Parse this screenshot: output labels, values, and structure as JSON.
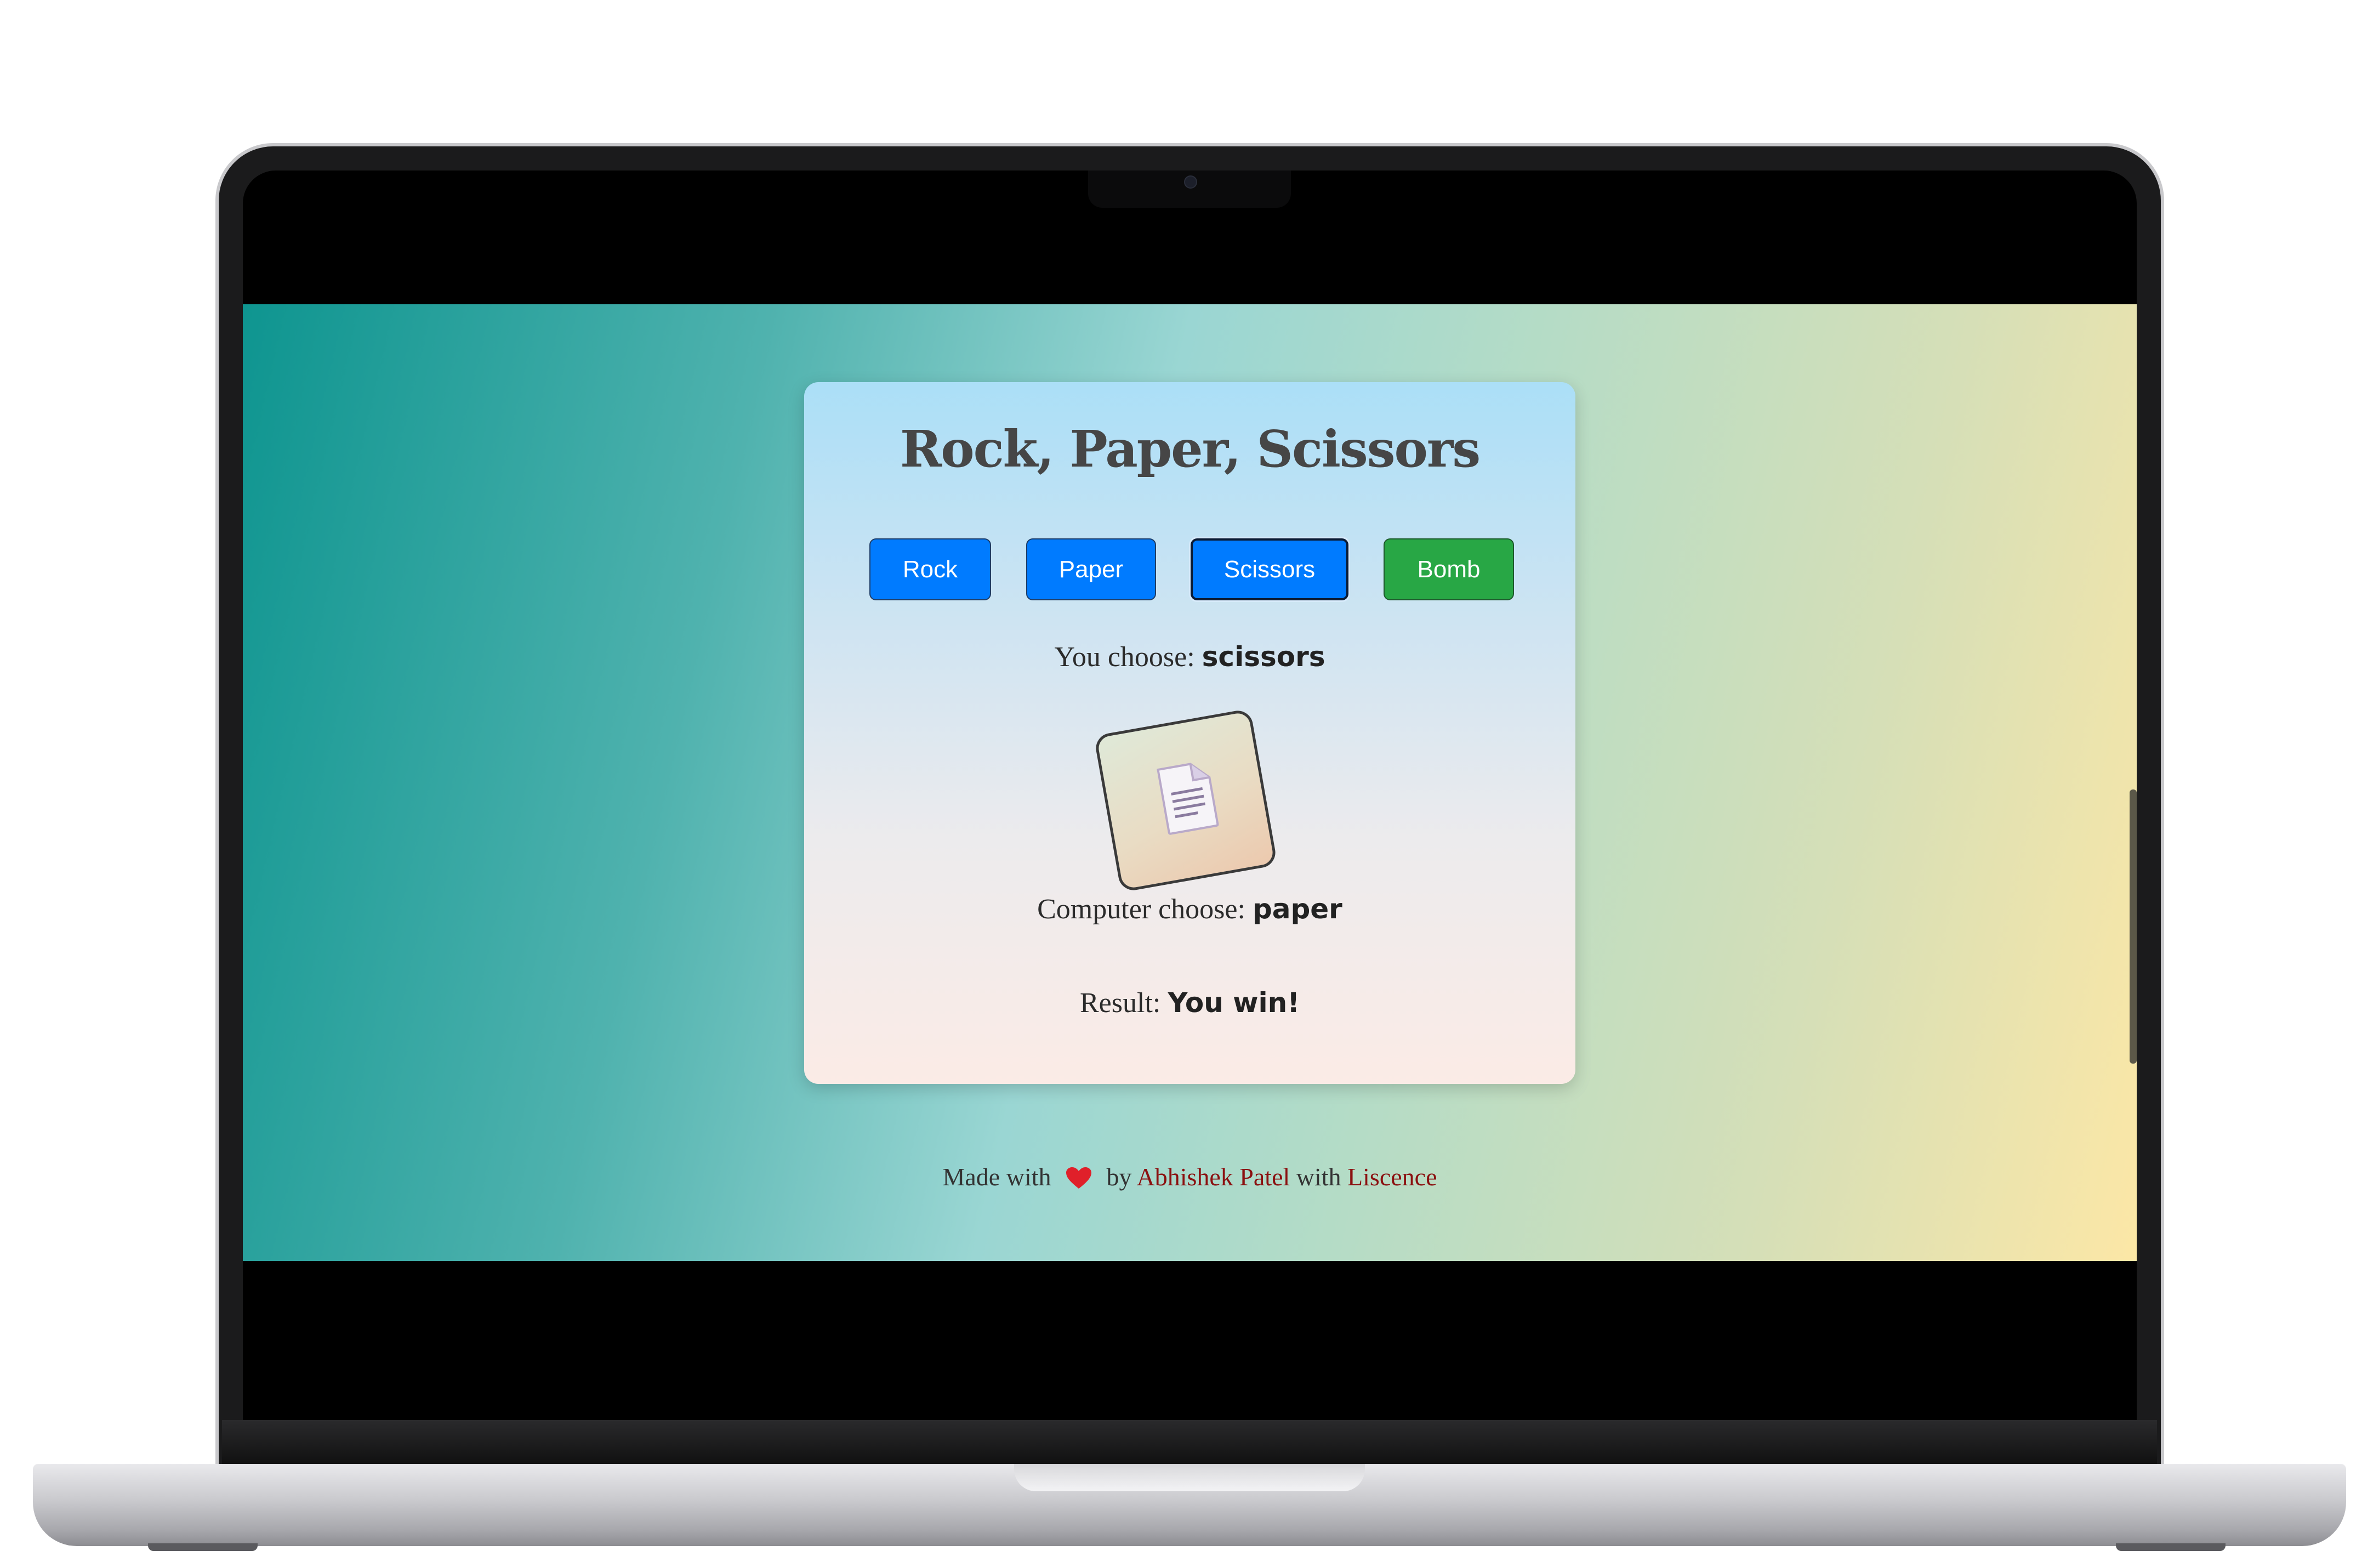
{
  "app": {
    "title": "Rock, Paper, Scissors"
  },
  "buttons": [
    {
      "label": "Rock"
    },
    {
      "label": "Paper"
    },
    {
      "label": "Scissors"
    },
    {
      "label": "Bomb"
    }
  ],
  "game": {
    "you_prefix": "You choose: ",
    "you_choice": "scissors",
    "computer_prefix": "Computer choose: ",
    "computer_choice": "paper",
    "result_prefix": "Result: ",
    "result_value": "You win!",
    "computer_image_icon": "document-icon"
  },
  "footer": {
    "made_with": "Made with",
    "heart_icon": "heart-icon",
    "by": "by",
    "author": "Abhishek Patel",
    "with": "with",
    "licence": "Liscence"
  },
  "colors": {
    "primary_button": "#007bff",
    "bomb_button": "#28a745",
    "link": "#8b1010"
  }
}
